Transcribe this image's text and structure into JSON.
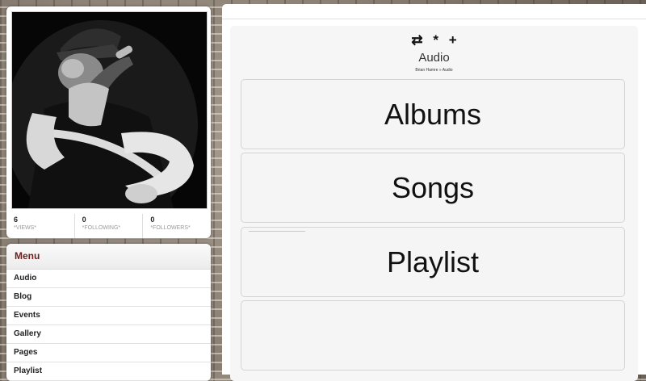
{
  "profile": {
    "stats": [
      {
        "value": "6",
        "label": "*VIEWS*"
      },
      {
        "value": "0",
        "label": "*FOLLOWING*"
      },
      {
        "value": "0",
        "label": "*FOLLOWERS*"
      }
    ]
  },
  "menu": {
    "title": "Menu",
    "items": [
      "Audio",
      "Blog",
      "Events",
      "Gallery",
      "Pages",
      "Playlist"
    ]
  },
  "header": {
    "icons": [
      "⇄",
      "*",
      "+"
    ],
    "title": "Audio",
    "breadcrumb": "Brian Hamre » Audio"
  },
  "cards": [
    "Albums",
    "Songs",
    "Playlist",
    ""
  ]
}
